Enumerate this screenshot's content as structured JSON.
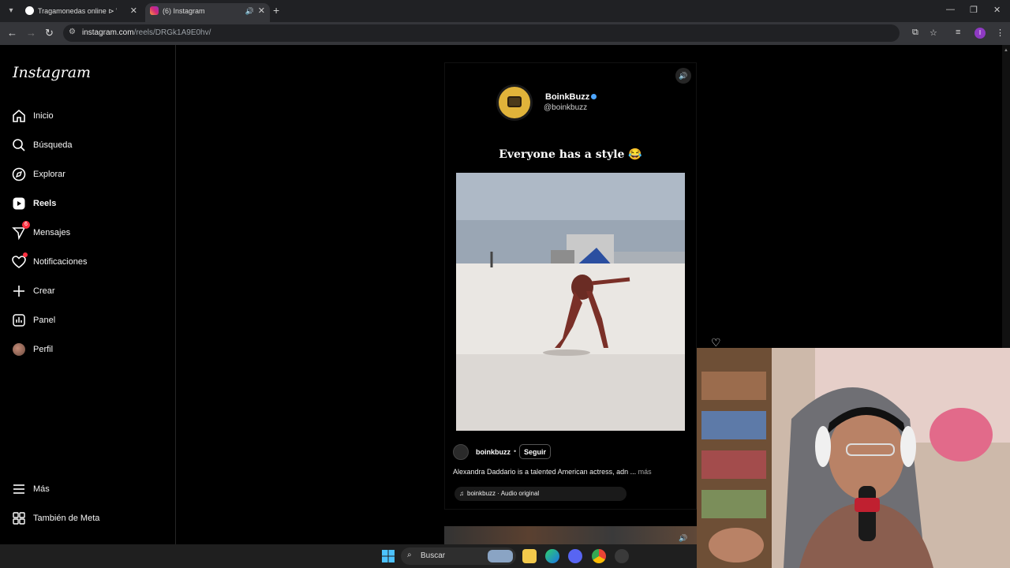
{
  "browser": {
    "tabs": [
      {
        "title": "Tragamonedas online ⊳ WinеB",
        "active": false
      },
      {
        "title": "(6) Instagram",
        "active": true
      }
    ],
    "url_host": "instagram.com",
    "url_path": "/reels/DRGk1A9E0hv/"
  },
  "sidebar": {
    "logo": "Instagram",
    "items": [
      {
        "label": "Inicio",
        "icon": "home-icon"
      },
      {
        "label": "Búsqueda",
        "icon": "search-icon"
      },
      {
        "label": "Explorar",
        "icon": "compass-icon"
      },
      {
        "label": "Reels",
        "icon": "reels-icon",
        "active": true
      },
      {
        "label": "Mensajes",
        "icon": "messenger-icon",
        "badge": "6"
      },
      {
        "label": "Notificaciones",
        "icon": "heart-icon",
        "dot": true
      },
      {
        "label": "Crear",
        "icon": "plus-icon"
      },
      {
        "label": "Panel",
        "icon": "chart-icon"
      },
      {
        "label": "Perfil",
        "icon": "avatar"
      }
    ],
    "bottom": [
      {
        "label": "Más",
        "icon": "menu-icon"
      },
      {
        "label": "También de Meta",
        "icon": "meta-icon"
      }
    ]
  },
  "reel": {
    "brand_name": "BoinkBuzz",
    "brand_handle": "@boinkbuzz",
    "headline": "Everyone has a style 😂",
    "username": "boinkbuzz",
    "separator": "•",
    "follow_label": "Seguir",
    "description": "Alexandra Daddario is a talented American actress, adn ...",
    "more_label": "más",
    "audio": "boinkbuzz · Audio original"
  },
  "taskbar": {
    "search_label": "Buscar"
  },
  "colors": {
    "accent_red": "#ff3040",
    "verified_blue": "#4da6ff",
    "brand_yellow": "#e0b33a"
  }
}
